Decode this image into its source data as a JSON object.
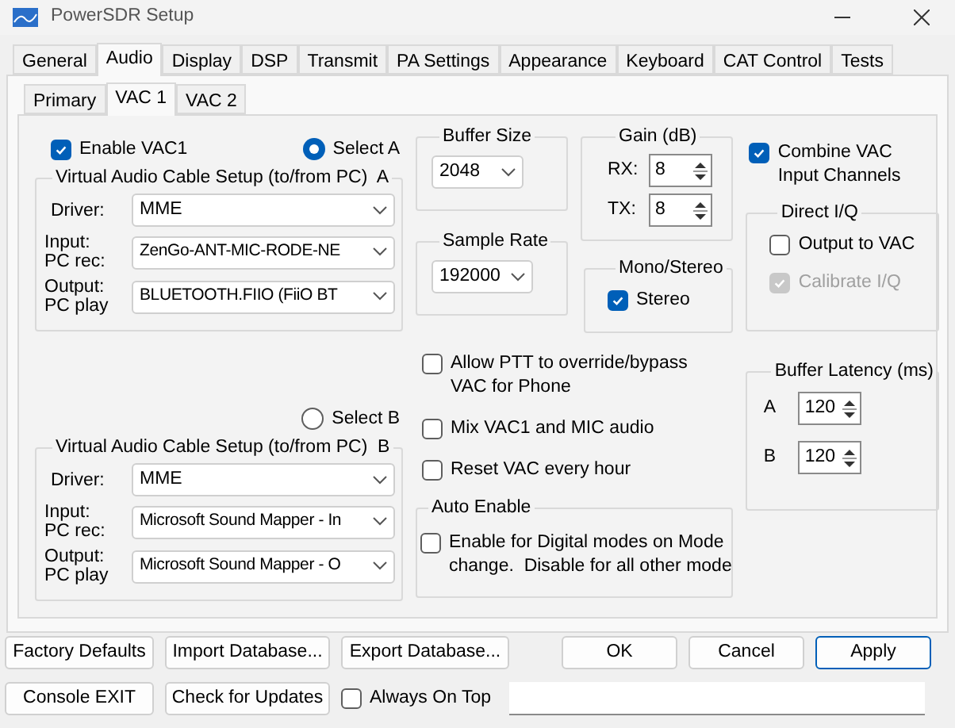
{
  "window": {
    "title": "PowerSDR Setup"
  },
  "tabs": [
    {
      "label": "General",
      "selected": false
    },
    {
      "label": "Audio",
      "selected": true
    },
    {
      "label": "Display",
      "selected": false
    },
    {
      "label": "DSP",
      "selected": false
    },
    {
      "label": "Transmit",
      "selected": false
    },
    {
      "label": "PA Settings",
      "selected": false
    },
    {
      "label": "Appearance",
      "selected": false
    },
    {
      "label": "Keyboard",
      "selected": false
    },
    {
      "label": "CAT Control",
      "selected": false
    },
    {
      "label": "Tests",
      "selected": false
    }
  ],
  "sub_tabs": [
    {
      "label": "Primary",
      "selected": false
    },
    {
      "label": "VAC 1",
      "selected": true
    },
    {
      "label": "VAC 2",
      "selected": false
    }
  ],
  "enable_vac": {
    "label": "Enable VAC1",
    "checked": true
  },
  "vac_setups": [
    {
      "radio": {
        "label": "Select A",
        "selected": true
      },
      "title": "Virtual Audio Cable Setup (to/from PC)  A",
      "fields": [
        {
          "label": "Driver:",
          "value": "MME"
        },
        {
          "label": "Input:\nPC rec:",
          "value": "ZenGo-ANT-MIC-RODE-NE"
        },
        {
          "label": "Output:\nPC play",
          "value": "BLUETOOTH.FIIO (FiiO BT"
        }
      ]
    },
    {
      "radio": {
        "label": "Select B",
        "selected": false
      },
      "title": "Virtual Audio Cable Setup (to/from PC)  B",
      "fields": [
        {
          "label": "Driver:",
          "value": "MME"
        },
        {
          "label": "Input:\nPC rec:",
          "value": "Microsoft Sound Mapper - In"
        },
        {
          "label": "Output:\nPC play",
          "value": "Microsoft Sound Mapper - O"
        }
      ]
    }
  ],
  "buffer_size": {
    "title": "Buffer Size",
    "value": "2048"
  },
  "sample_rate": {
    "title": "Sample Rate",
    "value": "192000"
  },
  "gain": {
    "title": "Gain (dB)",
    "rows": [
      {
        "label": "RX:",
        "value": "8"
      },
      {
        "label": "TX:",
        "value": "8"
      }
    ]
  },
  "mono_stereo": {
    "title": "Mono/Stereo",
    "checkbox": {
      "label": "Stereo",
      "checked": true
    }
  },
  "options": [
    {
      "label": "Allow PTT to override/bypass\nVAC for Phone",
      "checked": false
    },
    {
      "label": "Mix VAC1 and MIC audio",
      "checked": false
    },
    {
      "label": "Reset VAC every hour",
      "checked": false
    }
  ],
  "auto_enable": {
    "title": "Auto Enable",
    "checkbox": {
      "label": "Enable for Digital modes on Mode\nchange.  Disable for all other mode",
      "checked": false
    }
  },
  "combine_vac": {
    "label": "Combine VAC\nInput Channels",
    "checked": true
  },
  "direct_iq": {
    "title": "Direct I/Q",
    "items": [
      {
        "label": "Output to VAC",
        "checked": false,
        "disabled": false
      },
      {
        "label": "Calibrate I/Q",
        "checked": true,
        "disabled": true
      }
    ]
  },
  "buffer_latency": {
    "title": "Buffer Latency (ms)",
    "rows": [
      {
        "label": "A",
        "value": "120"
      },
      {
        "label": "B",
        "value": "120"
      }
    ]
  },
  "buttons": [
    {
      "label": "Factory Defaults",
      "default": false
    },
    {
      "label": "Import Database...",
      "default": false
    },
    {
      "label": "Export Database...",
      "default": false
    },
    {
      "label": "OK",
      "default": false
    },
    {
      "label": "Cancel",
      "default": false
    },
    {
      "label": "Apply",
      "default": true
    }
  ],
  "bottom_buttons": [
    {
      "label": "Console EXIT"
    },
    {
      "label": "Check for Updates"
    }
  ],
  "always_on_top": {
    "label": "Always On Top",
    "checked": false
  }
}
